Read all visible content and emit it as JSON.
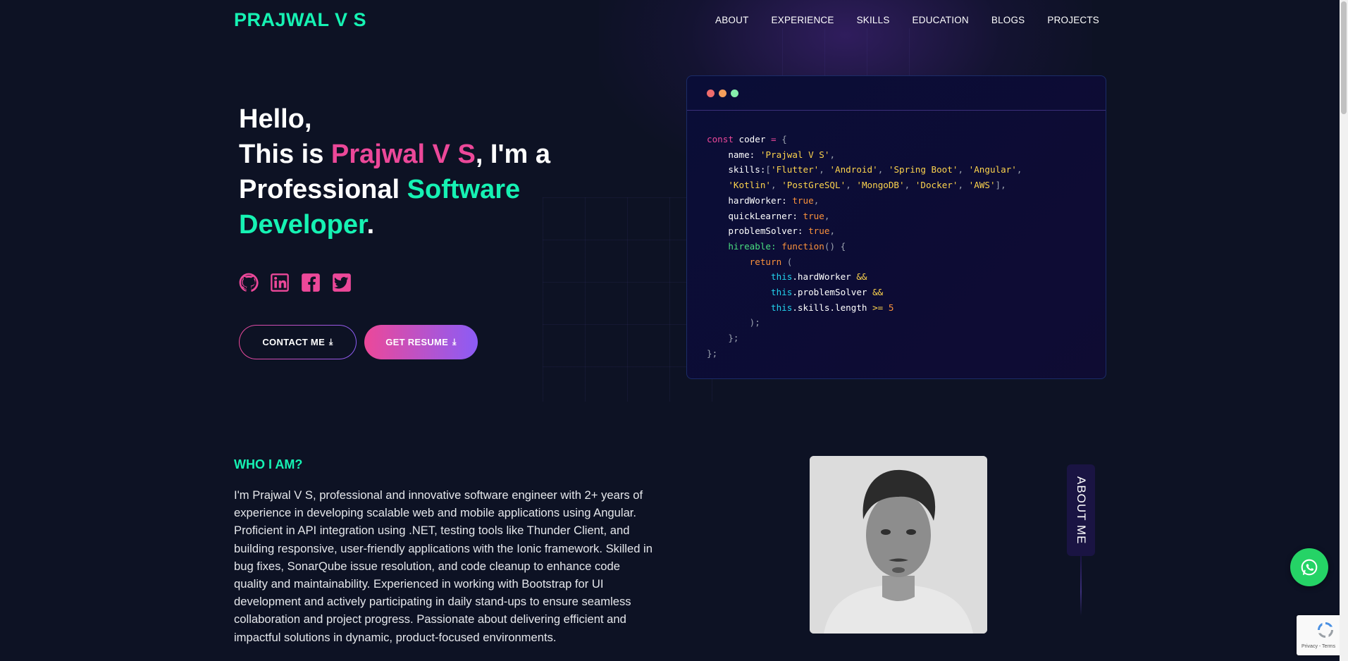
{
  "nav": {
    "logo": "PRAJWAL V S",
    "links": [
      "ABOUT",
      "EXPERIENCE",
      "SKILLS",
      "EDUCATION",
      "BLOGS",
      "PROJECTS"
    ]
  },
  "hero": {
    "line1": "Hello,",
    "line2_prefix": "This is ",
    "name": "Prajwal V S",
    "line2_suffix": ", I'm a",
    "line3_prefix": "Professional ",
    "role_part1": "Software",
    "role_part2": "Developer",
    "period": "."
  },
  "socials": [
    "github-icon",
    "linkedin-icon",
    "facebook-icon",
    "twitter-icon"
  ],
  "buttons": {
    "contact": "CONTACT ME",
    "resume": "GET RESUME"
  },
  "code": {
    "dots": [
      "#ef6c6c",
      "#f59e5b",
      "#86efac"
    ],
    "const_kw": "const",
    "var": "coder",
    "name_key": "name:",
    "name_val": "'Prajwal V S'",
    "skills_key": "skills:",
    "skills_line1": [
      "'Flutter'",
      "'Android'",
      "'Spring Boot'",
      "'Angular'"
    ],
    "skills_line2": [
      "'Kotlin'",
      "'PostGreSQL'",
      "'MongoDB'",
      "'Docker'",
      "'AWS'"
    ],
    "hardWorker_key": "hardWorker:",
    "quickLearner_key": "quickLearner:",
    "problemSolver_key": "problemSolver:",
    "true_val": "true",
    "hireable_key": "hireable:",
    "function_kw": "function",
    "return_kw": "return",
    "this_kw": "this",
    "cond1": ".hardWorker",
    "cond2": ".problemSolver",
    "cond3": ".skills.length",
    "and_op": "&&",
    "gte_op": ">=",
    "num": "5"
  },
  "about": {
    "heading": "WHO I AM?",
    "text": "I'm Prajwal V S, professional and innovative software engineer with 2+ years of experience in developing scalable web and mobile applications using Angular. Proficient in API integration using .NET, testing tools like Thunder Client, and building responsive, user-friendly applications with the Ionic framework. Skilled in bug fixes, SonarQube issue resolution, and code cleanup to enhance code quality and maintainability. Experienced in working with Bootstrap for UI development and actively participating in daily stand-ups to ensure seamless collaboration and project progress. Passionate about delivering efficient and impactful solutions in dynamic, product-focused environments.",
    "tab": "ABOUT ME"
  },
  "recaptcha": {
    "text": "Privacy - Terms"
  },
  "colors": {
    "accent_green": "#16f2b3",
    "accent_pink": "#ec4899",
    "accent_purple": "#8b5cf6",
    "bg": "#0d1224",
    "whatsapp": "#25d366"
  }
}
